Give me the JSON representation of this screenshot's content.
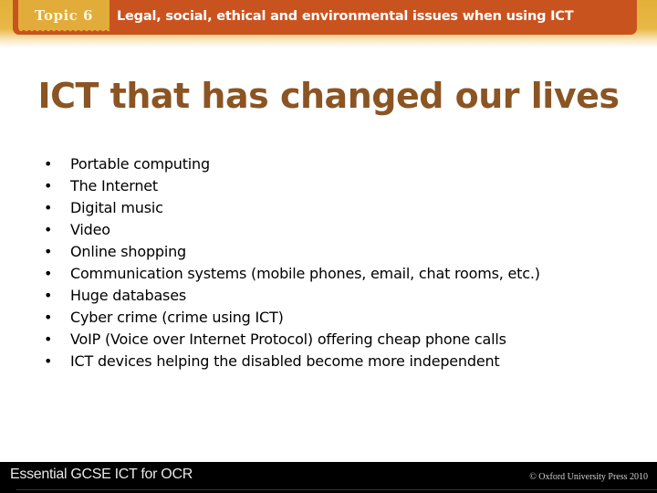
{
  "header": {
    "topic_label": "Topic 6",
    "title": "Legal, social, ethical and environmental issues when using ICT"
  },
  "slide": {
    "title": "ICT that has changed our lives",
    "bullet_symbol": "•",
    "bullets": [
      "Portable computing",
      "The Internet",
      "Digital music",
      "Video",
      "Online shopping",
      "Communication systems (mobile phones, email, chat rooms, etc.)",
      "Huge databases",
      "Cyber crime (crime using ICT)",
      "VoIP (Voice over Internet Protocol) offering cheap phone calls",
      "ICT devices helping the disabled become more independent"
    ]
  },
  "footer": {
    "book_title": "Essential GCSE ICT for OCR",
    "copyright": "© Oxford University Press 2010"
  },
  "colors": {
    "header_orange": "#c9531f",
    "topic_gold": "#e2ac3a",
    "band_gold": "#e3b13a",
    "title_brown": "#8b5523",
    "footer_black": "#000000"
  }
}
